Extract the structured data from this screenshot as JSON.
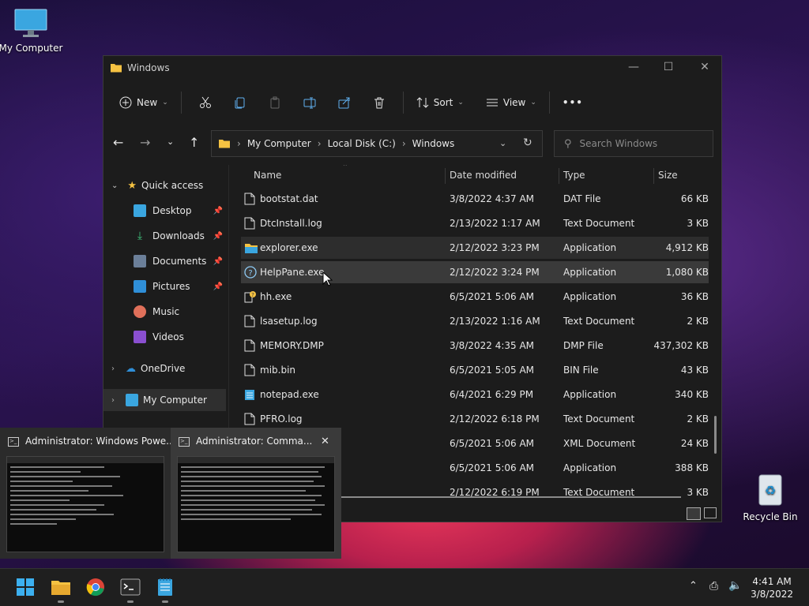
{
  "desktop": {
    "icons": [
      {
        "label": "My Computer",
        "icon": "monitor-icon"
      },
      {
        "label": "Recycle Bin",
        "icon": "recycle-bin-icon"
      }
    ]
  },
  "window": {
    "title": "Windows",
    "controls": {
      "minimize": "—",
      "maximize": "☐",
      "close": "✕"
    },
    "toolbar": {
      "new_label": "New",
      "sort_label": "Sort",
      "view_label": "View",
      "more_label": "•••"
    },
    "breadcrumb": [
      "My Computer",
      "Local Disk (C:)",
      "Windows"
    ],
    "search_placeholder": "Search Windows",
    "sidebar": {
      "quick_access": "Quick access",
      "items": [
        {
          "label": "Desktop",
          "pinned": true,
          "icon": "desktop-folder-icon"
        },
        {
          "label": "Downloads",
          "pinned": true,
          "icon": "download-icon"
        },
        {
          "label": "Documents",
          "pinned": true,
          "icon": "documents-icon"
        },
        {
          "label": "Pictures",
          "pinned": true,
          "icon": "pictures-icon"
        },
        {
          "label": "Music",
          "pinned": false,
          "icon": "music-icon"
        },
        {
          "label": "Videos",
          "pinned": false,
          "icon": "videos-icon"
        }
      ],
      "onedrive": "OneDrive",
      "my_computer": "My Computer"
    },
    "columns": {
      "name": "Name",
      "date": "Date modified",
      "type": "Type",
      "size": "Size"
    },
    "files": [
      {
        "name": "bootstat.dat",
        "date": "3/8/2022 4:37 AM",
        "type": "DAT File",
        "size": "66 KB",
        "icon": "file-icon",
        "state": ""
      },
      {
        "name": "DtcInstall.log",
        "date": "2/13/2022 1:17 AM",
        "type": "Text Document",
        "size": "3 KB",
        "icon": "file-icon",
        "state": ""
      },
      {
        "name": "explorer.exe",
        "date": "2/12/2022 3:23 PM",
        "type": "Application",
        "size": "4,912 KB",
        "icon": "folder-app-icon",
        "state": "hov"
      },
      {
        "name": "HelpPane.exe",
        "date": "2/12/2022 3:24 PM",
        "type": "Application",
        "size": "1,080 KB",
        "icon": "help-icon",
        "state": "sel"
      },
      {
        "name": "hh.exe",
        "date": "6/5/2021 5:06 AM",
        "type": "Application",
        "size": "36 KB",
        "icon": "help-doc-icon",
        "state": ""
      },
      {
        "name": "lsasetup.log",
        "date": "2/13/2022 1:16 AM",
        "type": "Text Document",
        "size": "2 KB",
        "icon": "file-icon",
        "state": ""
      },
      {
        "name": "MEMORY.DMP",
        "date": "3/8/2022 4:35 AM",
        "type": "DMP File",
        "size": "437,302 KB",
        "icon": "file-icon",
        "state": ""
      },
      {
        "name": "mib.bin",
        "date": "6/5/2021 5:05 AM",
        "type": "BIN File",
        "size": "43 KB",
        "icon": "file-icon",
        "state": ""
      },
      {
        "name": "notepad.exe",
        "date": "6/4/2021 6:29 PM",
        "type": "Application",
        "size": "340 KB",
        "icon": "notepad-icon",
        "state": ""
      },
      {
        "name": "PFRO.log",
        "date": "2/12/2022 6:18 PM",
        "type": "Text Document",
        "size": "2 KB",
        "icon": "file-icon",
        "state": ""
      },
      {
        "name": "",
        "date": "6/5/2021 5:06 AM",
        "type": "XML Document",
        "size": "24 KB",
        "icon": "file-icon",
        "state": ""
      },
      {
        "name": "",
        "date": "6/5/2021 5:06 AM",
        "type": "Application",
        "size": "388 KB",
        "icon": "file-icon",
        "state": ""
      },
      {
        "name": "",
        "date": "2/12/2022 6:19 PM",
        "type": "Text Document",
        "size": "3 KB",
        "icon": "file-icon",
        "state": ""
      }
    ]
  },
  "thumbnails": [
    {
      "title": "Administrator: Windows Powe...",
      "icon": "terminal-icon"
    },
    {
      "title": "Administrator: Comma...",
      "icon": "terminal-icon",
      "close": "✕"
    }
  ],
  "taskbar": {
    "apps": [
      "start-icon",
      "file-explorer-icon",
      "chrome-icon",
      "terminal-icon",
      "notepad-icon"
    ],
    "time": "4:41 AM",
    "date": "3/8/2022"
  }
}
